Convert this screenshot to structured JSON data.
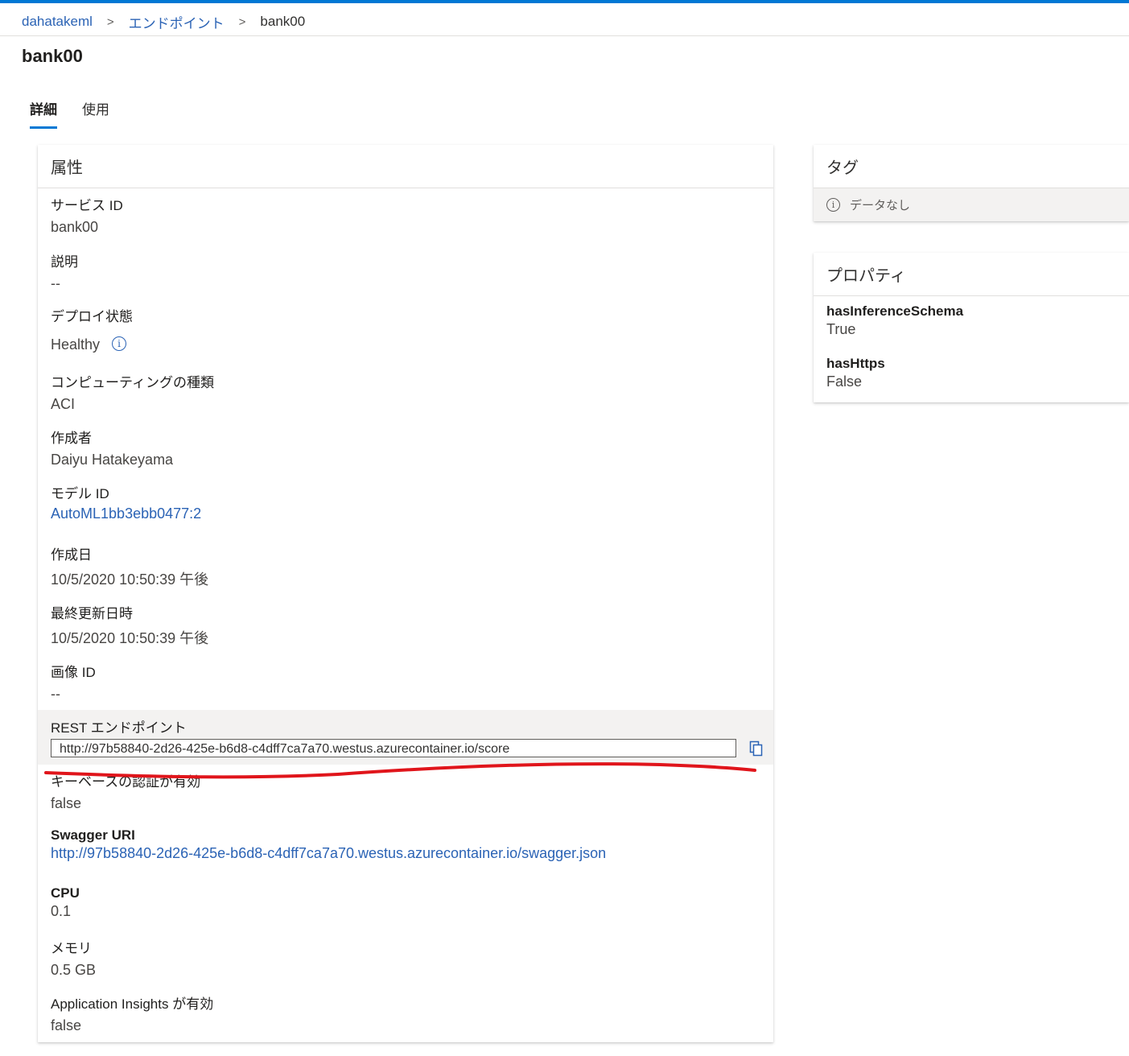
{
  "breadcrumb": {
    "workspace": "dahatakeml",
    "section": "エンドポイント",
    "current": "bank00",
    "separator": ">"
  },
  "page": {
    "title": "bank00"
  },
  "tabs": [
    {
      "label": "詳細",
      "active": true
    },
    {
      "label": "使用",
      "active": false
    }
  ],
  "attributes": {
    "header": "属性",
    "service_id": {
      "label": "サービス ID",
      "value": "bank00"
    },
    "description": {
      "label": "説明",
      "value": "--"
    },
    "deploy_state": {
      "label": "デプロイ状態",
      "value": "Healthy"
    },
    "compute_type": {
      "label": "コンピューティングの種類",
      "value": "ACI"
    },
    "created_by": {
      "label": "作成者",
      "value": "Daiyu Hatakeyama"
    },
    "model_id": {
      "label": "モデル ID",
      "value": "AutoML1bb3ebb0477:2"
    },
    "created_on": {
      "label": "作成日",
      "value": "10/5/2020 10:50:39 午後"
    },
    "updated_on": {
      "label": "最終更新日時",
      "value": "10/5/2020 10:50:39 午後"
    },
    "image_id": {
      "label": "画像 ID",
      "value": "--"
    },
    "rest_endpoint": {
      "label": "REST エンドポイント",
      "value": "http://97b58840-2d26-425e-b6d8-c4dff7ca7a70.westus.azurecontainer.io/score"
    },
    "key_auth": {
      "label": "キーベースの認証が有効",
      "value": "false"
    },
    "swagger": {
      "label": "Swagger URI",
      "value": "http://97b58840-2d26-425e-b6d8-c4dff7ca7a70.westus.azurecontainer.io/swagger.json"
    },
    "cpu": {
      "label": "CPU",
      "value": "0.1"
    },
    "memory": {
      "label": "メモリ",
      "value": "0.5 GB"
    },
    "app_insights": {
      "label": "Application Insights が有効",
      "value": "false"
    }
  },
  "tags": {
    "header": "タグ",
    "empty_text": "データなし"
  },
  "properties": {
    "header": "プロパティ",
    "items": [
      {
        "label": "hasInferenceSchema",
        "value": "True"
      },
      {
        "label": "hasHttps",
        "value": "False"
      }
    ]
  },
  "colors": {
    "accent": "#0078d4",
    "link": "#2b63b5",
    "annotation": "#e0151b"
  },
  "icons": {
    "info": "info-icon",
    "copy": "copy-icon",
    "chevron": "chevron-right-icon"
  }
}
